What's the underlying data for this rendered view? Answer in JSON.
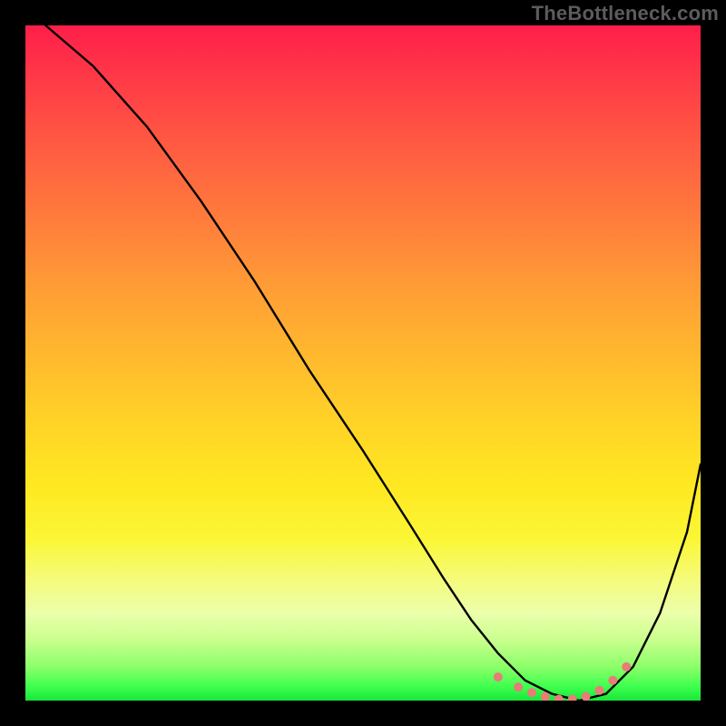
{
  "watermark": "TheBottleneck.com",
  "chart_data": {
    "type": "line",
    "title": "",
    "xlabel": "",
    "ylabel": "",
    "xlim": [
      0,
      100
    ],
    "ylim": [
      0,
      100
    ],
    "grid": false,
    "legend": "none",
    "series": [
      {
        "name": "bottleneck-curve",
        "x": [
          3,
          10,
          18,
          26,
          34,
          42,
          50,
          57,
          62,
          66,
          70,
          74,
          78,
          82,
          86,
          90,
          94,
          98,
          100
        ],
        "y": [
          100,
          94,
          85,
          74,
          62,
          49,
          37,
          26,
          18,
          12,
          7,
          3,
          1,
          0,
          1,
          5,
          13,
          25,
          35
        ],
        "color": "#000000"
      }
    ],
    "markers": {
      "name": "min-band-dots",
      "x": [
        70,
        73,
        75,
        77,
        79,
        81,
        83,
        85,
        87,
        89
      ],
      "y": [
        3.5,
        2.0,
        1.2,
        0.6,
        0.2,
        0.2,
        0.6,
        1.5,
        3.0,
        5.0
      ],
      "color": "#e87c78",
      "size": 5
    },
    "gradient_stops": [
      {
        "pos": 0.0,
        "color": "#ff1e4a"
      },
      {
        "pos": 0.08,
        "color": "#ff3a47"
      },
      {
        "pos": 0.18,
        "color": "#ff5b42"
      },
      {
        "pos": 0.28,
        "color": "#ff7a3c"
      },
      {
        "pos": 0.38,
        "color": "#ff9a36"
      },
      {
        "pos": 0.48,
        "color": "#ffb62f"
      },
      {
        "pos": 0.58,
        "color": "#ffd128"
      },
      {
        "pos": 0.68,
        "color": "#ffe821"
      },
      {
        "pos": 0.76,
        "color": "#fbf635"
      },
      {
        "pos": 0.82,
        "color": "#f5fb7a"
      },
      {
        "pos": 0.87,
        "color": "#ecffab"
      },
      {
        "pos": 0.91,
        "color": "#c9ff8e"
      },
      {
        "pos": 0.95,
        "color": "#8cff6a"
      },
      {
        "pos": 0.98,
        "color": "#3dff4d"
      },
      {
        "pos": 1.0,
        "color": "#17e63a"
      }
    ]
  }
}
